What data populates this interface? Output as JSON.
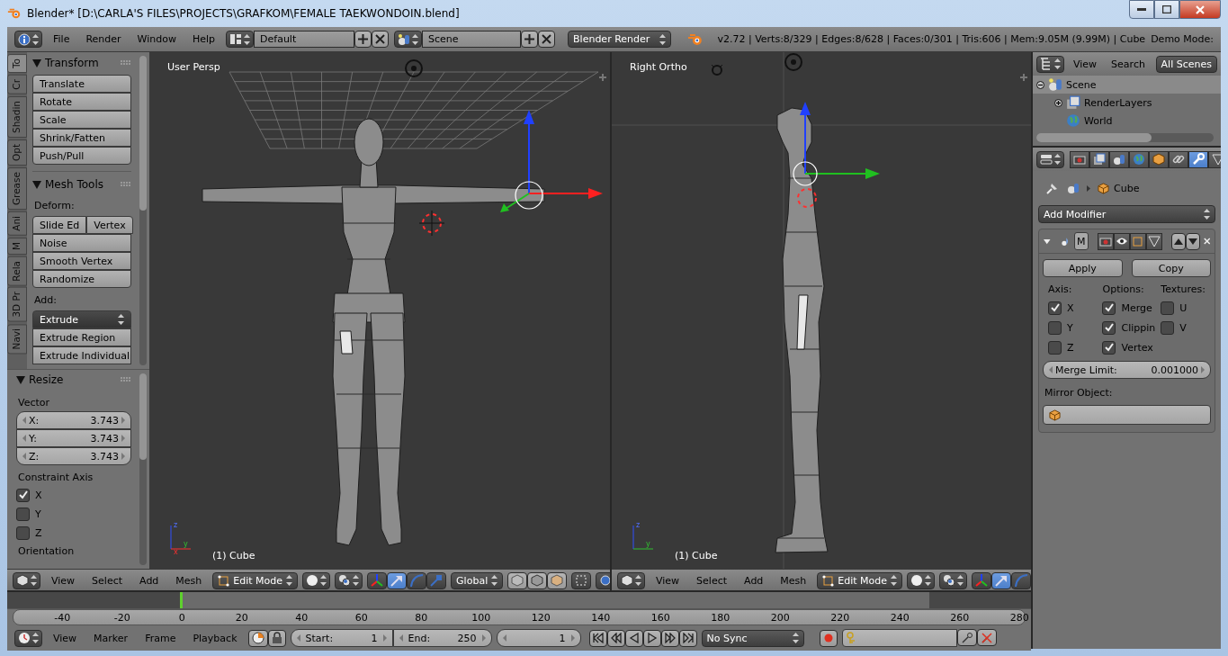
{
  "window": {
    "title": "Blender* [D:\\CARLA'S FILES\\PROJECTS\\GRAFKOM\\FEMALE TAEKWONDOIN.blend]"
  },
  "info_header": {
    "menus": [
      "File",
      "Render",
      "Window",
      "Help"
    ],
    "screen_layout": "Default",
    "scene": "Scene",
    "render_engine": "Blender Render",
    "stats": "v2.72 | Verts:8/329 | Edges:8/628 | Faces:0/301 | Tris:606 | Mem:9.05M (9.99M) | Cube",
    "demo_mode": "Demo Mode:"
  },
  "tool_shelf": {
    "tabs": [
      {
        "label": "To",
        "selected": true
      },
      {
        "label": "Cr",
        "selected": false
      },
      {
        "label": "Shadin",
        "selected": false
      },
      {
        "label": "Opt",
        "selected": false
      },
      {
        "label": "Grease",
        "selected": false
      },
      {
        "label": "Ani",
        "selected": false
      },
      {
        "label": "M",
        "selected": false
      },
      {
        "label": "Rela",
        "selected": false
      },
      {
        "label": "3D Pr",
        "selected": false
      },
      {
        "label": "Navi",
        "selected": false
      }
    ],
    "transform": {
      "title": "Transform",
      "buttons": [
        "Translate",
        "Rotate",
        "Scale",
        "Shrink/Fatten",
        "Push/Pull"
      ]
    },
    "mesh_tools": {
      "title": "Mesh Tools",
      "deform_label": "Deform:",
      "deform_pair": [
        "Slide Ed",
        "Vertex"
      ],
      "deform_buttons": [
        "Noise",
        "Smooth Vertex",
        "Randomize"
      ],
      "add_label": "Add:",
      "extrude_menu": "Extrude",
      "add_buttons": [
        "Extrude Region",
        "Extrude Individual"
      ]
    }
  },
  "operator_panel": {
    "title": "Resize",
    "vector_label": "Vector",
    "vector": [
      {
        "label": "X:",
        "value": "3.743"
      },
      {
        "label": "Y:",
        "value": "3.743"
      },
      {
        "label": "Z:",
        "value": "3.743"
      }
    ],
    "constraint_label": "Constraint Axis",
    "constraints": [
      {
        "label": "X",
        "checked": true
      },
      {
        "label": "Y",
        "checked": false
      },
      {
        "label": "Z",
        "checked": false
      }
    ],
    "orientation_label": "Orientation"
  },
  "viewports": [
    {
      "kind": "front",
      "label": "User Persp",
      "object": "(1) Cube",
      "axis_labels": [
        "z",
        "y",
        "x"
      ],
      "header": {
        "menus": [
          "View",
          "Select",
          "Add",
          "Mesh"
        ],
        "mode": "Edit Mode",
        "transform_tools": [
          {
            "kind": "toggle",
            "selected": false
          },
          {
            "kind": "translate",
            "selected": true
          },
          {
            "kind": "rotate",
            "selected": false
          },
          {
            "kind": "scale",
            "selected": false
          }
        ],
        "orientation": "Global"
      }
    },
    {
      "kind": "side",
      "label": "Right Ortho",
      "object": "(1) Cube",
      "axis_labels": [
        "z",
        "y"
      ],
      "header": {
        "menus": [
          "View",
          "Select",
          "Add",
          "Mesh"
        ],
        "mode": "Edit Mode",
        "transform_tools": [
          {
            "kind": "toggle",
            "selected": false
          },
          {
            "kind": "translate",
            "selected": true
          },
          {
            "kind": "rotate",
            "selected": false
          }
        ]
      }
    }
  ],
  "outliner": {
    "menus": [
      "View",
      "Search"
    ],
    "filter": "All Scenes",
    "items": [
      {
        "label": "Scene",
        "kind": "scene",
        "selected": true,
        "expanded": true,
        "children": [
          {
            "label": "RenderLayers",
            "kind": "layers",
            "selected": false,
            "expanded": false
          },
          {
            "label": "World",
            "kind": "world",
            "selected": false
          }
        ]
      }
    ]
  },
  "properties": {
    "context_tabs": [
      {
        "kind": "render",
        "selected": false
      },
      {
        "kind": "layers",
        "selected": false
      },
      {
        "kind": "scene",
        "selected": false
      },
      {
        "kind": "world",
        "selected": false
      },
      {
        "kind": "object",
        "selected": false
      },
      {
        "kind": "constraints",
        "selected": false
      },
      {
        "kind": "modifiers",
        "selected": true
      },
      {
        "kind": "data",
        "selected": false
      }
    ],
    "breadcrumb": "Cube",
    "add_modifier": "Add Modifier",
    "modifier": {
      "name": "M",
      "apply": "Apply",
      "copy": "Copy",
      "columns": [
        {
          "title": "Axis:",
          "options": [
            {
              "label": "X",
              "checked": true
            },
            {
              "label": "Y",
              "checked": false
            },
            {
              "label": "Z",
              "checked": false
            }
          ]
        },
        {
          "title": "Options:",
          "options": [
            {
              "label": "Merge",
              "checked": true
            },
            {
              "label": "Clippin",
              "checked": true
            },
            {
              "label": "Vertex",
              "checked": true
            }
          ]
        },
        {
          "title": "Textures:",
          "options": [
            {
              "label": "U",
              "checked": false
            },
            {
              "label": "V",
              "checked": false
            }
          ]
        }
      ],
      "merge_limit_label": "Merge Limit:",
      "merge_limit": "0.001000",
      "mirror_object_label": "Mirror Object:"
    }
  },
  "timeline": {
    "ruler_labels": [
      "-40",
      "-20",
      "0",
      "20",
      "40",
      "60",
      "80",
      "100",
      "120",
      "140",
      "160",
      "180",
      "200",
      "220",
      "240",
      "260",
      "280"
    ],
    "menus": [
      "View",
      "Marker",
      "Frame",
      "Playback"
    ],
    "start_label": "Start:",
    "start": "1",
    "end_label": "End:",
    "end": "250",
    "current": "1",
    "sync": "No Sync"
  }
}
